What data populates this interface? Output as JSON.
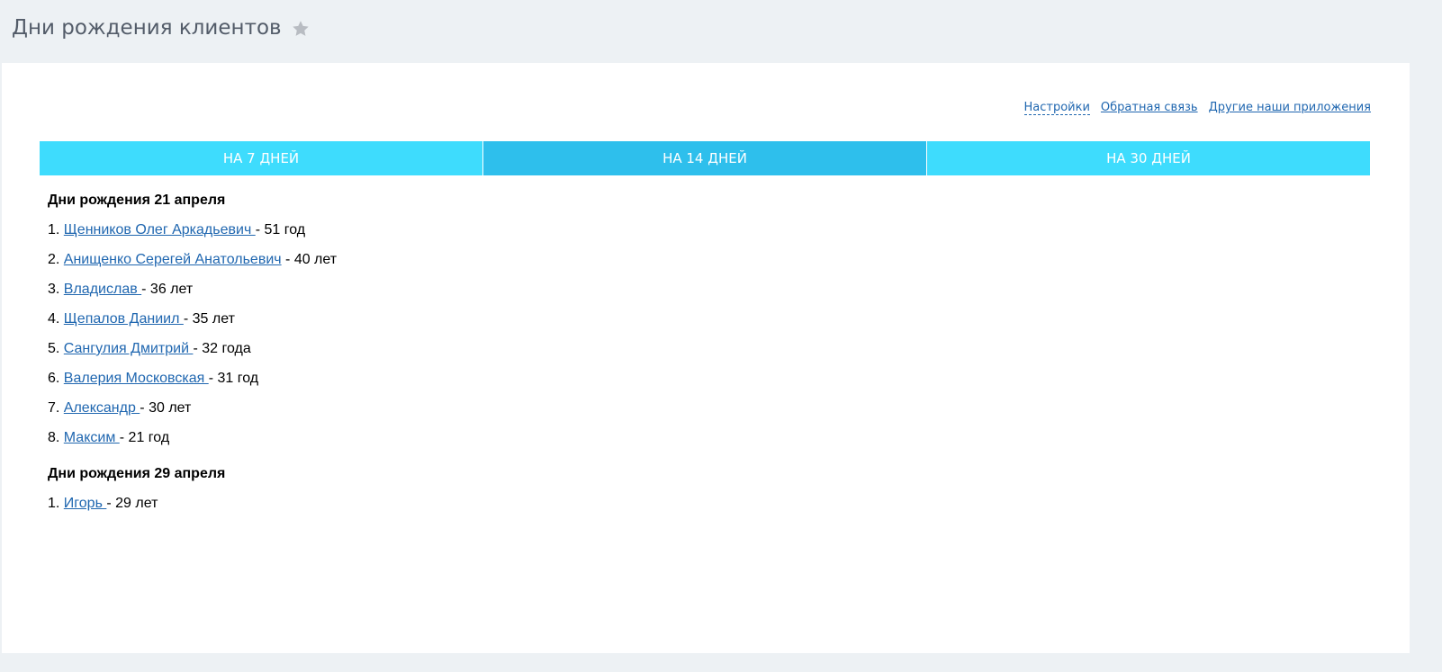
{
  "header": {
    "title": "Дни рождения клиентов",
    "favorite_icon": "star-icon"
  },
  "top_links": {
    "settings": "Настройки",
    "feedback": "Обратная связь",
    "other_apps": "Другие наши приложения"
  },
  "tabs": [
    {
      "label": "НА 7 ДНЕЙ",
      "active": false
    },
    {
      "label": "НА 14 ДНЕЙ",
      "active": true
    },
    {
      "label": "НА 30 ДНЕЙ",
      "active": false
    }
  ],
  "colors": {
    "tab": "#3edcfd",
    "tab_active": "#2ebfec",
    "link": "#2067b0",
    "header_bg": "#edf1f4"
  },
  "groups": [
    {
      "title": "Дни рождения 21 апреля",
      "entries": [
        {
          "num": "1.",
          "name": "Щенников Олег Аркадьевич ",
          "age": " - 51 год"
        },
        {
          "num": "2.",
          "name": "Анищенко Серегей Анатольевич",
          "age": " - 40 лет"
        },
        {
          "num": "3.",
          "name": "Владислав ",
          "age": " - 36 лет"
        },
        {
          "num": "4.",
          "name": "Щепалов Даниил ",
          "age": " - 35 лет"
        },
        {
          "num": "5.",
          "name": "Сангулия Дмитрий ",
          "age": " - 32 года"
        },
        {
          "num": "6.",
          "name": "Валерия Московская ",
          "age": " - 31 год"
        },
        {
          "num": "7.",
          "name": "Александр ",
          "age": " - 30 лет"
        },
        {
          "num": "8.",
          "name": "Максим ",
          "age": " - 21 год"
        }
      ]
    },
    {
      "title": "Дни рождения 29 апреля",
      "entries": [
        {
          "num": "1.",
          "name": "Игорь ",
          "age": " - 29 лет"
        }
      ]
    }
  ]
}
